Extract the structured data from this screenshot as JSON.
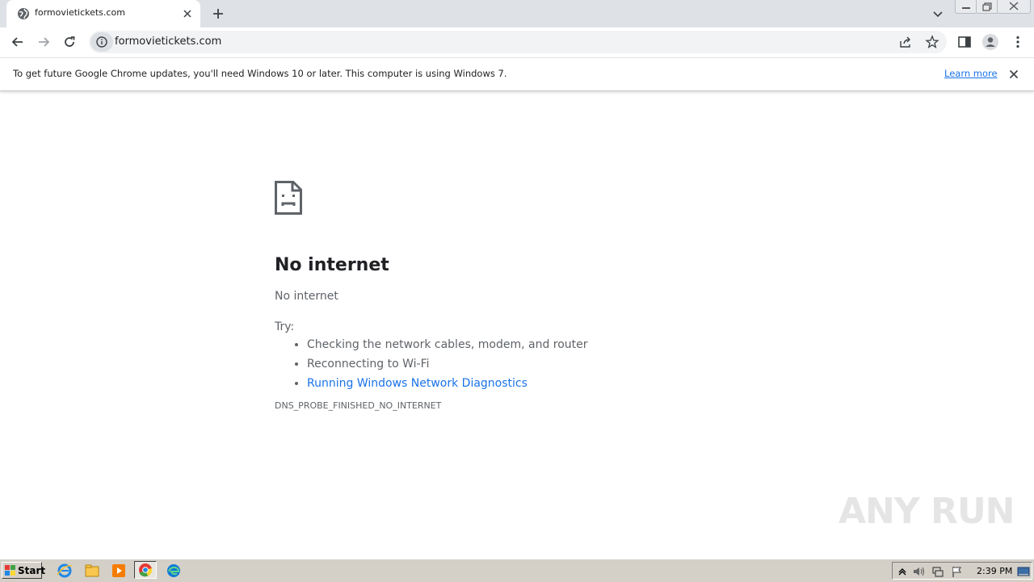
{
  "tab": {
    "title": "formovietickets.com",
    "favicon": "globe-icon"
  },
  "toolbar": {
    "url": "formovietickets.com"
  },
  "infobar": {
    "message": "To get future Google Chrome updates, you'll need Windows 10 or later. This computer is using Windows 7.",
    "link": "Learn more"
  },
  "error": {
    "title": "No internet",
    "subtitle": "No internet",
    "try_label": "Try:",
    "suggestions": [
      "Checking the network cables, modem, and router",
      "Reconnecting to Wi-Fi"
    ],
    "diagnostics_link": "Running Windows Network Diagnostics",
    "code": "DNS_PROBE_FINISHED_NO_INTERNET"
  },
  "watermark": "ANY RUN",
  "taskbar": {
    "start_label": "Start",
    "clock": "2:39 PM"
  },
  "colors": {
    "accent": "#1a73e8",
    "tabstrip": "#dee1e6",
    "text_secondary": "#5f6368",
    "taskbar": "#d4d0c8"
  }
}
